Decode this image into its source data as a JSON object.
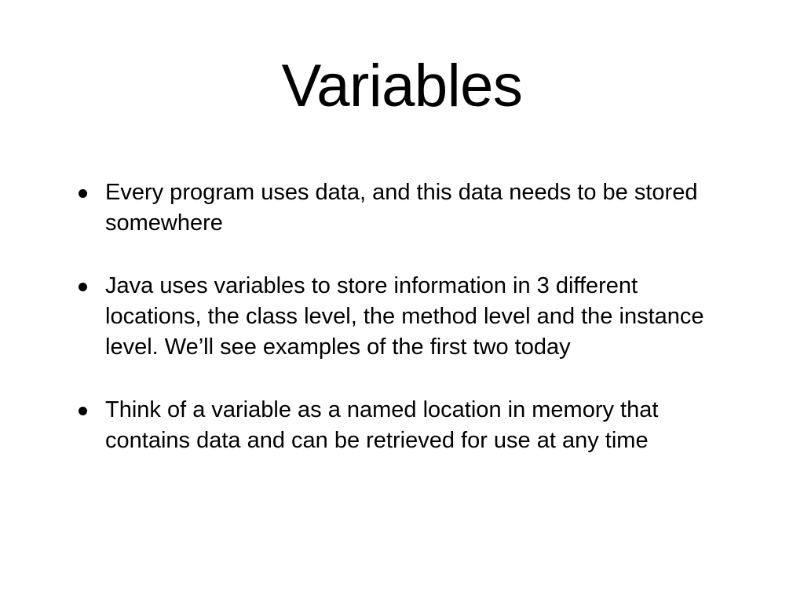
{
  "slide": {
    "title": "Variables",
    "bullets": [
      "Every program uses data, and this data needs to be stored somewhere",
      "Java uses variables to store information in 3 different locations, the class level, the method level and the instance level. We’ll see examples of the first two today",
      "Think of a variable as a named location in memory that contains data and can be retrieved for use at any time"
    ]
  }
}
